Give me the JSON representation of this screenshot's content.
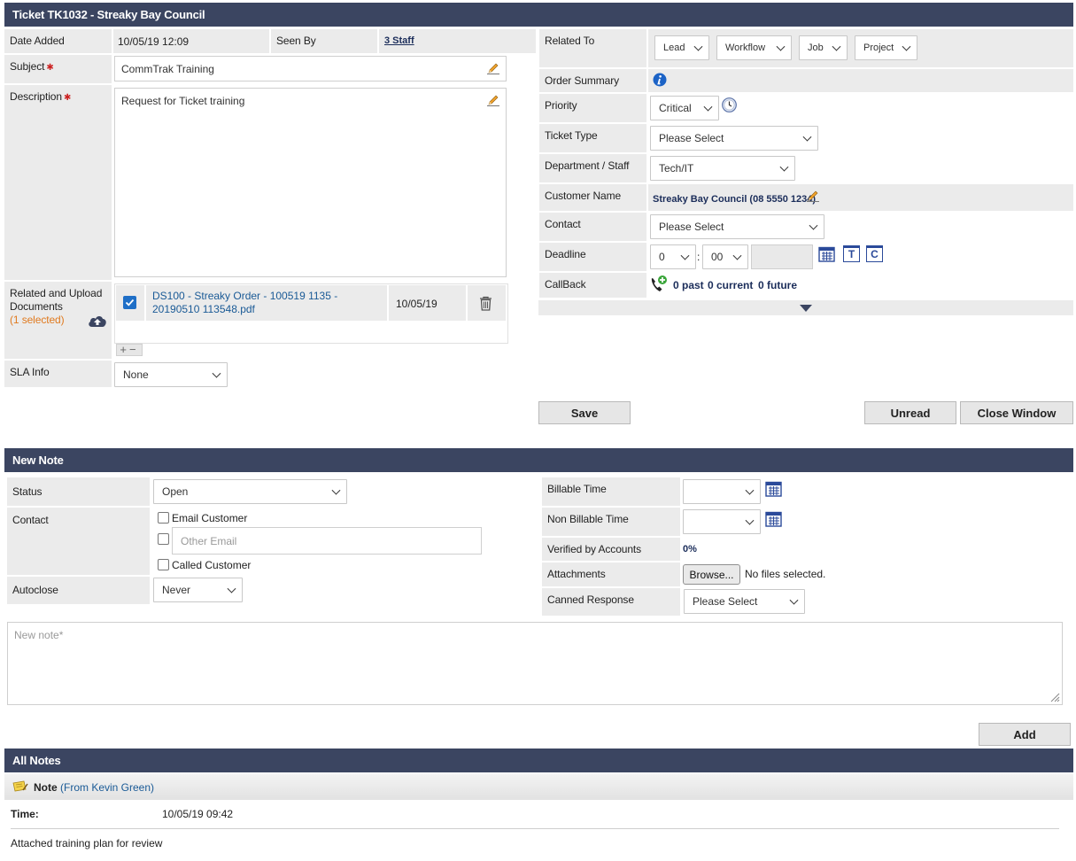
{
  "ticket": {
    "title": "Ticket TK1032 - Streaky Bay Council",
    "date_added_label": "Date Added",
    "date_added": "10/05/19 12:09",
    "seen_by_label": "Seen By",
    "seen_by": "3 Staff",
    "subject_label": "Subject",
    "subject": "CommTrak Training",
    "description_label": "Description",
    "description": "Request for Ticket training",
    "docs_label": "Related and Upload Documents",
    "docs_selected": "(1 selected)",
    "doc_name": "DS100 - Streaky Order - 100519 1135 - 20190510 113548.pdf",
    "doc_date": "10/05/19",
    "add_remove": "+−",
    "sla_label": "SLA Info",
    "sla_value": "None",
    "related_to_label": "Related To",
    "related_lead": "Lead",
    "related_workflow": "Workflow",
    "related_job": "Job",
    "related_project": "Project",
    "order_summary_label": "Order Summary",
    "priority_label": "Priority",
    "priority_value": "Critical",
    "ticket_type_label": "Ticket Type",
    "ticket_type_value": "Please Select",
    "department_label": "Department / Staff",
    "department_value": "Tech/IT",
    "customer_label": "Customer Name",
    "customer_value": "Streaky Bay Council (08 5550 1234)",
    "contact_label": "Contact",
    "contact_value": "Please Select",
    "deadline_label": "Deadline",
    "deadline_hour": "0",
    "deadline_sep": ":",
    "deadline_min": "00",
    "cal_t": "T",
    "cal_c": "C",
    "callback_label": "CallBack",
    "callback_past": "0 past",
    "callback_current": "0 current",
    "callback_future": "0 future",
    "save": "Save",
    "unread": "Unread",
    "close_window": "Close Window"
  },
  "new_note": {
    "title": "New Note",
    "status_label": "Status",
    "status_value": "Open",
    "contact_label": "Contact",
    "email_customer": "Email Customer",
    "other_email_placeholder": "Other Email",
    "called_customer": "Called Customer",
    "autoclose_label": "Autoclose",
    "autoclose_value": "Never",
    "billable_label": "Billable Time",
    "non_billable_label": "Non Billable Time",
    "verified_label": "Verified by Accounts",
    "verified_value": "0%",
    "attachments_label": "Attachments",
    "browse": "Browse...",
    "no_files": "No files selected.",
    "canned_label": "Canned Response",
    "canned_value": "Please Select",
    "note_placeholder": "New note*",
    "add": "Add"
  },
  "all_notes": {
    "title": "All Notes",
    "note_label": "Note",
    "note_from": "(From Kevin Green)",
    "time_label": "Time:",
    "time_value": "10/05/19 09:42",
    "note_text": "Attached training plan for review"
  },
  "colors": {
    "header": "#3b4561",
    "label_bg": "#ebebeb",
    "link": "#1a5a96",
    "selected_orange": "#e07a1f",
    "calendar_blue": "#2b4a9a"
  }
}
